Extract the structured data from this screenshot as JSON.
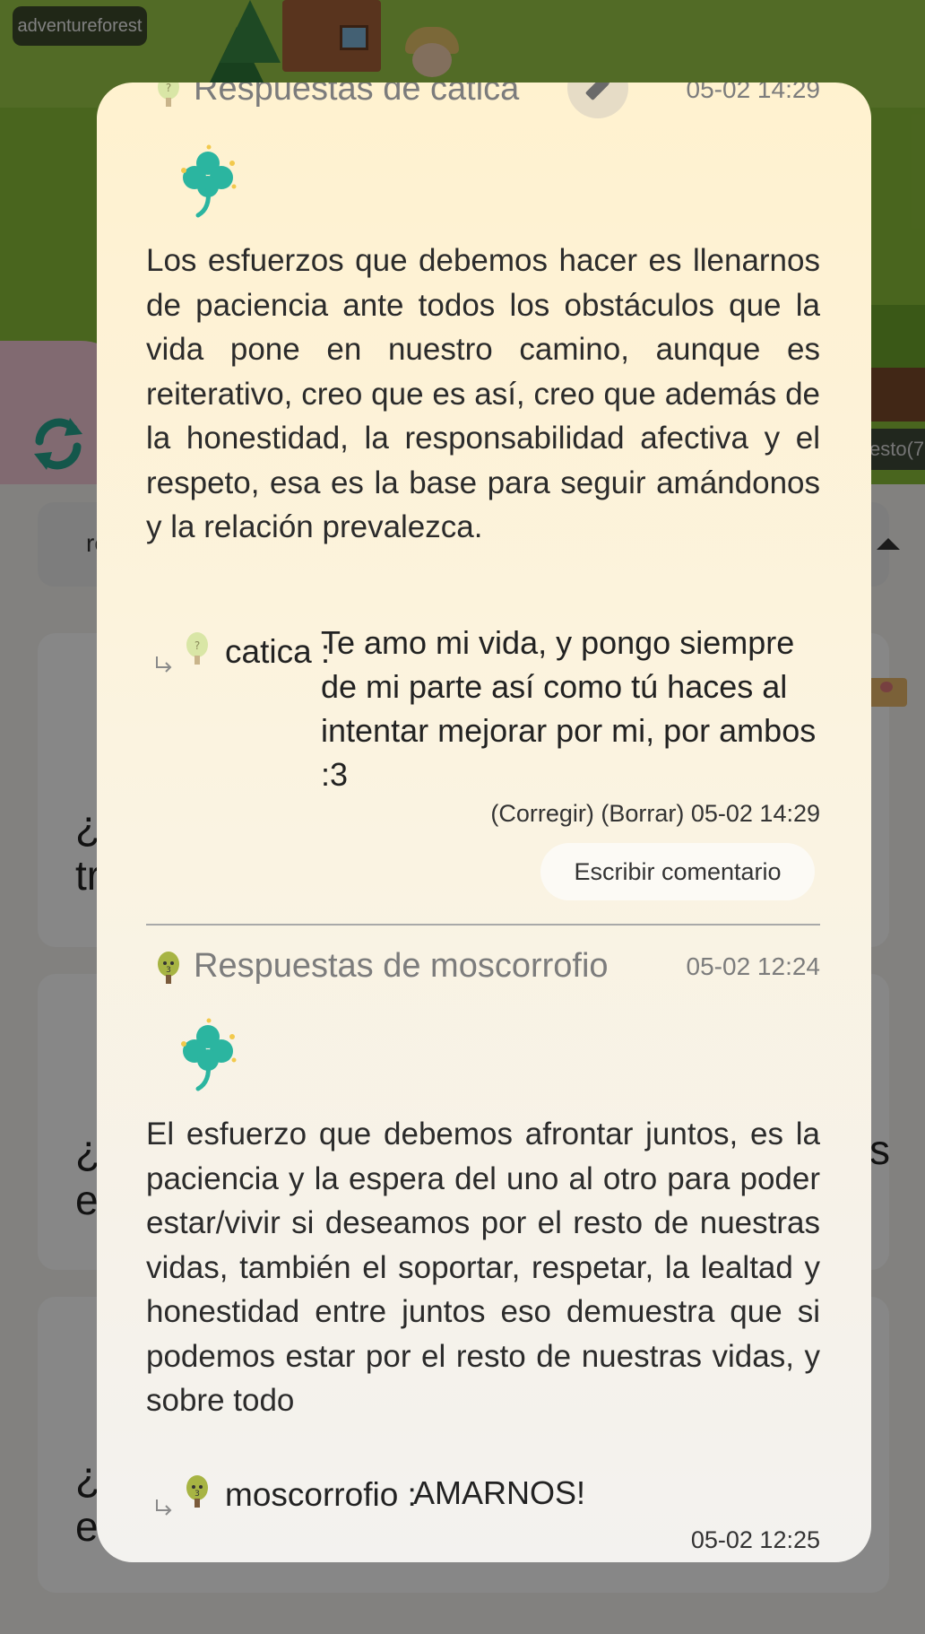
{
  "background": {
    "site_tag": "adventureforest",
    "right_chip": "esto(7",
    "search_partial": "re",
    "question_partials": [
      "¿S\ntr",
      "¿C\ne",
      "¿C\ne"
    ],
    "right_partial_s": "s"
  },
  "modal": {
    "answers": [
      {
        "title": "Respuestas de catica",
        "date": "05-02 14:29",
        "body": "Los esfuerzos que debemos hacer es llenarnos de paciencia ante todos los obstáculos que la vida pone en nuestro camino, aunque es reiterativo, creo que es así, creo que además de la honestidad, la responsabilidad afectiva y el respeto, esa es la base para seguir  amándonos y la relación prevalezca.",
        "reply": {
          "name": "catica :",
          "text": "Te amo mi vida, y pongo siempre de mi parte así como tú haces al intentar mejorar por mi, por ambos :3",
          "correct_label": "(Corregir)",
          "delete_label": "(Borrar)",
          "date": "05-02 14:29"
        },
        "comment_button": "Escribir comentario"
      },
      {
        "title": "Respuestas de moscorrofio",
        "date": "05-02 12:24",
        "body": "El esfuerzo que debemos afrontar juntos, es la paciencia y la espera del uno al otro para poder estar/vivir si deseamos por el resto de nuestras vidas, también el soportar, respetar, la lealtad y honestidad entre juntos eso demuestra que si podemos estar por el resto de nuestras vidas, y sobre todo",
        "reply": {
          "name": "moscorrofio :",
          "text": "AMARNOS!",
          "date": "05-02 12:25"
        }
      }
    ],
    "colors": {
      "modal_top": "#fff2cf",
      "modal_bottom": "#f3f2ef",
      "meta_text": "#7c7c7c",
      "clover": "#2bb5a0"
    },
    "icons": [
      "pencil-icon",
      "clover-icon",
      "reply-arrow-icon",
      "tree-avatar-icon",
      "refresh-icon"
    ]
  }
}
